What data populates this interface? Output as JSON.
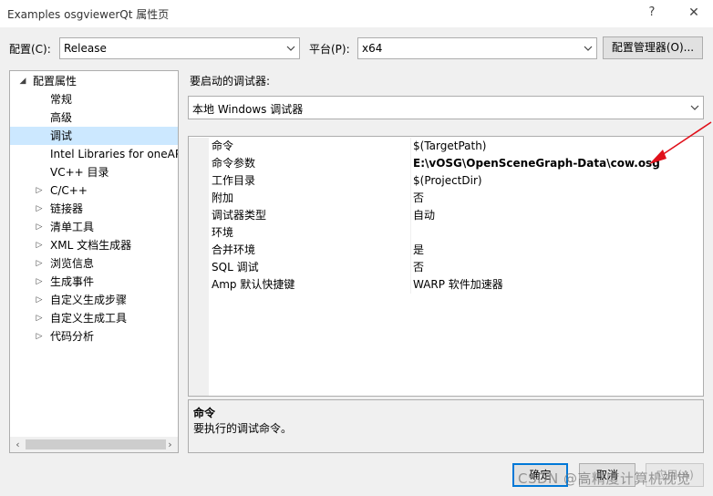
{
  "window": {
    "title": "Examples osgviewerQt 属性页",
    "help_label": "?",
    "close_label": "✕"
  },
  "toolbar": {
    "config_label": "配置(C):",
    "config_value": "Release",
    "platform_label": "平台(P):",
    "platform_value": "x64",
    "config_manager_label": "配置管理器(O)..."
  },
  "tree": {
    "items": [
      {
        "label": "配置属性",
        "arrow": "◢"
      },
      {
        "label": "常规",
        "arrow": ""
      },
      {
        "label": "高级",
        "arrow": ""
      },
      {
        "label": "调试",
        "arrow": ""
      },
      {
        "label": "Intel Libraries for oneAPI",
        "arrow": ""
      },
      {
        "label": "VC++ 目录",
        "arrow": ""
      },
      {
        "label": "C/C++",
        "arrow": "▷"
      },
      {
        "label": "链接器",
        "arrow": "▷"
      },
      {
        "label": "清单工具",
        "arrow": "▷"
      },
      {
        "label": "XML 文档生成器",
        "arrow": "▷"
      },
      {
        "label": "浏览信息",
        "arrow": "▷"
      },
      {
        "label": "生成事件",
        "arrow": "▷"
      },
      {
        "label": "自定义生成步骤",
        "arrow": "▷"
      },
      {
        "label": "自定义生成工具",
        "arrow": "▷"
      },
      {
        "label": "代码分析",
        "arrow": "▷"
      }
    ],
    "selected": "调试",
    "scroll_left": "‹",
    "scroll_right": "›"
  },
  "debugger": {
    "label": "要启动的调试器:",
    "value": "本地 Windows 调试器"
  },
  "properties": [
    {
      "name": "命令",
      "value": "$(TargetPath)"
    },
    {
      "name": "命令参数",
      "value": "E:\\vOSG\\OpenSceneGraph-Data\\cow.osg"
    },
    {
      "name": "工作目录",
      "value": "$(ProjectDir)"
    },
    {
      "name": "附加",
      "value": "否"
    },
    {
      "name": "调试器类型",
      "value": "自动"
    },
    {
      "name": "环境",
      "value": ""
    },
    {
      "name": "合并环境",
      "value": "是"
    },
    {
      "name": "SQL 调试",
      "value": "否"
    },
    {
      "name": "Amp 默认快捷键",
      "value": "WARP 软件加速器"
    }
  ],
  "description": {
    "title": "命令",
    "text": "要执行的调试命令。"
  },
  "buttons": {
    "ok": "确定",
    "cancel": "取消",
    "apply": "应用(A)"
  },
  "watermark": "CSDN @高精度计算机视觉",
  "colors": {
    "selection": "#cce8ff",
    "accent": "#0078d7",
    "annotation_arrow": "#e0101a"
  }
}
